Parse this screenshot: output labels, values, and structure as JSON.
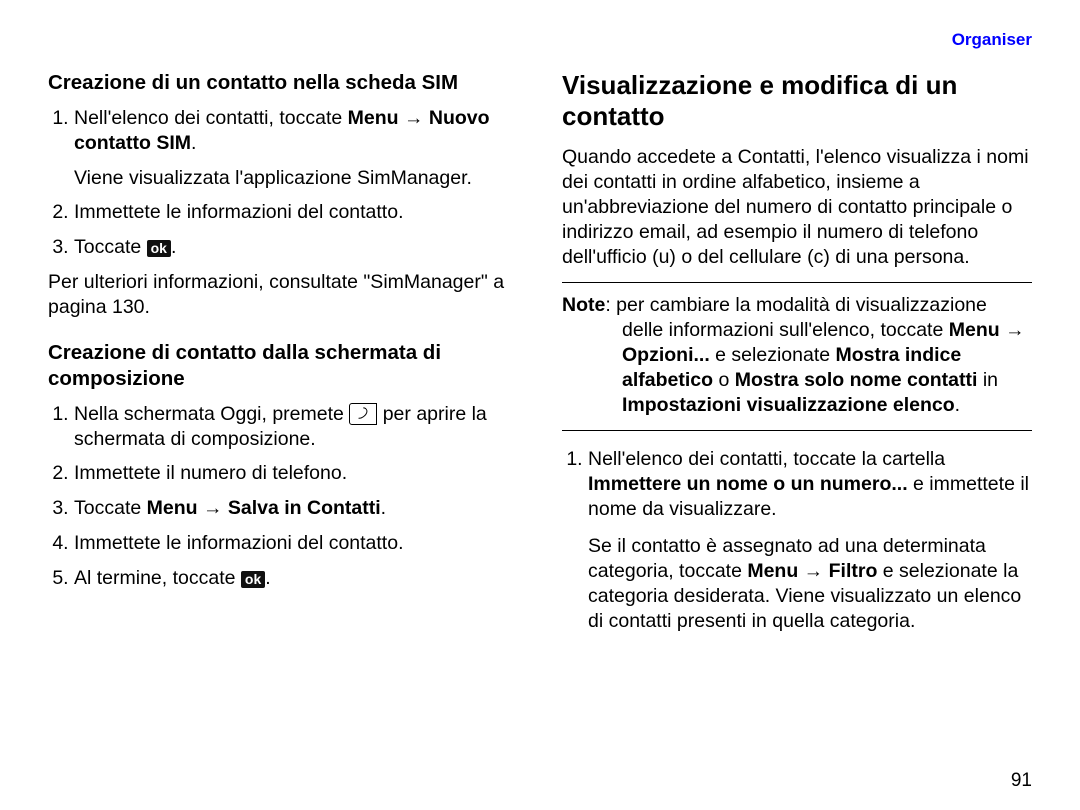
{
  "header": {
    "section_link": "Organiser"
  },
  "left": {
    "h3_a": "Creazione di un contatto nella scheda SIM",
    "steps_a": {
      "s1_pre": "Nell'elenco dei contatti, toccate ",
      "s1_b1": "Menu",
      "s1_arrow": " → ",
      "s1_b2": "Nuovo contatto SIM",
      "s1_post": ".",
      "s1_sub": "Viene visualizzata l'applicazione SimManager.",
      "s2": "Immettete le informazioni del contatto.",
      "s3_pre": "Toccate ",
      "s3_post": "."
    },
    "after_a": "Per ulteriori informazioni, consultate \"SimManager\" a pagina 130.",
    "h3_b": "Creazione di contatto dalla schermata di composizione",
    "steps_b": {
      "s1_pre": "Nella schermata Oggi, premete ",
      "s1_post": " per aprire la schermata di composizione.",
      "s2": "Immettete il numero di telefono.",
      "s3_pre": "Toccate ",
      "s3_b1": "Menu",
      "s3_arrow": " → ",
      "s3_b2": "Salva in Contatti",
      "s3_post": ".",
      "s4": "Immettete le informazioni del contatto.",
      "s5_pre": "Al termine, toccate ",
      "s5_post": "."
    }
  },
  "right": {
    "h2": "Visualizzazione e modifica di un contatto",
    "intro": "Quando accedete a Contatti, l'elenco visualizza i nomi dei contatti in ordine alfabetico, insieme a un'abbreviazione del numero di contatto principale o indirizzo email, ad esempio il numero di telefono dell'ufficio (u) o del cellulare (c) di una persona.",
    "note": {
      "label": "Note",
      "t1": ": per cambiare la modalità di visualizzazione delle informazioni sull'elenco, toccate ",
      "b1": "Menu",
      "arrow": " → ",
      "b2": "Opzioni...",
      "t2": " e selezionate ",
      "b3": "Mostra indice alfabetico",
      "t3": " o ",
      "b4": "Mostra solo nome contatti",
      "t4": " in ",
      "b5": "Impostazioni visualizzazione elenco",
      "t5": "."
    },
    "steps": {
      "s1_t1": "Nell'elenco dei contatti, toccate la cartella ",
      "s1_b1": "Immettere un nome o un numero...",
      "s1_t2": " e immettete il nome da visualizzare.",
      "s1_sub_t1": "Se il contatto è assegnato ad una determinata categoria, toccate ",
      "s1_sub_b1": "Menu",
      "s1_sub_arrow": " → ",
      "s1_sub_b2": "Filtro",
      "s1_sub_t2": " e selezionate la categoria desiderata. Viene visualizzato un elenco di contatti presenti in quella categoria."
    }
  },
  "icons": {
    "ok": "ok"
  },
  "page_number": "91"
}
